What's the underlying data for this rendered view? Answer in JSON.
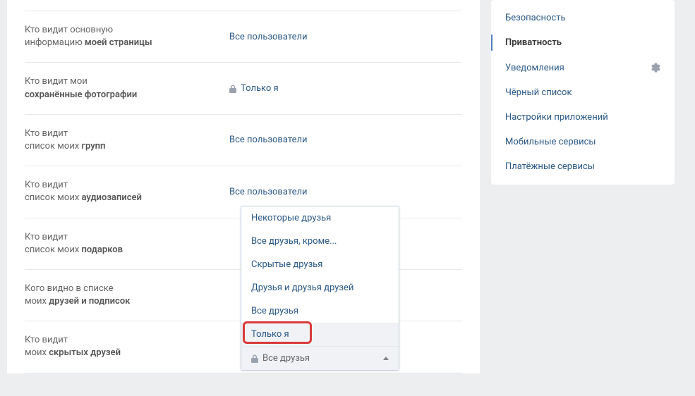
{
  "settings": [
    {
      "label_pre": "Кто видит основную",
      "label_post": "информацию ",
      "label_bold": "моей страницы",
      "value": "Все пользователи",
      "locked": false
    },
    {
      "label_pre": "Кто видит мои",
      "label_post": "",
      "label_bold": "сохранённые фотографии",
      "value": "Только я",
      "locked": true
    },
    {
      "label_pre": "Кто видит",
      "label_post": "список моих ",
      "label_bold": "групп",
      "value": "Все пользователи",
      "locked": false
    },
    {
      "label_pre": "Кто видит",
      "label_post": "список моих ",
      "label_bold": "аудиозаписей",
      "value": "Все пользователи",
      "locked": false
    },
    {
      "label_pre": "Кто видит",
      "label_post": "список моих ",
      "label_bold": "подарков",
      "value": "",
      "locked": false
    },
    {
      "label_pre": "Кого видно в списке",
      "label_post": "моих ",
      "label_bold": "друзей и подписок",
      "value": "",
      "locked": false
    },
    {
      "label_pre": "Кто видит",
      "label_post": "моих ",
      "label_bold": "скрытых друзей",
      "value": "",
      "locked": false
    }
  ],
  "dropdown": {
    "options": [
      "Некоторые друзья",
      "Все друзья, кроме...",
      "Скрытые друзья",
      "Друзья и друзья друзей",
      "Все друзья",
      "Только я"
    ],
    "highlighted_index": 5,
    "footer_label": "Все друзья"
  },
  "sidebar": {
    "items": [
      {
        "label": "Безопасность",
        "active": false
      },
      {
        "label": "Приватность",
        "active": true
      },
      {
        "label": "Уведомления",
        "active": false,
        "gear": true
      },
      {
        "label": "Чёрный список",
        "active": false
      },
      {
        "label": "Настройки приложений",
        "active": false
      },
      {
        "label": "Мобильные сервисы",
        "active": false
      },
      {
        "label": "Платёжные сервисы",
        "active": false
      }
    ]
  }
}
